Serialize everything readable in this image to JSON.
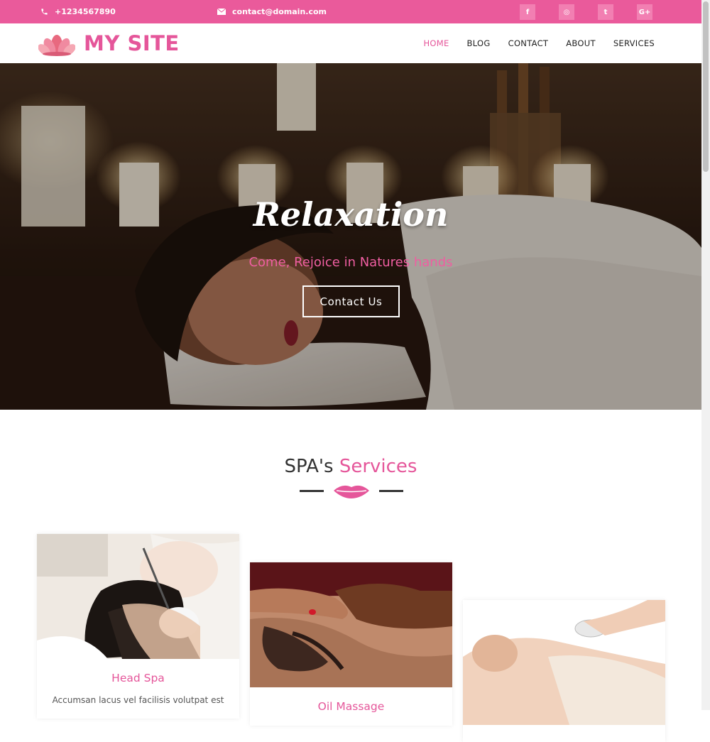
{
  "topbar": {
    "phone": "+1234567890",
    "email": "contact@domain.com",
    "phone_icon": "phone-icon",
    "email_icon": "envelope-icon",
    "socials": [
      {
        "name": "facebook-icon",
        "glyph": "f"
      },
      {
        "name": "instagram-icon",
        "glyph": "◎"
      },
      {
        "name": "twitter-icon",
        "glyph": "t"
      },
      {
        "name": "google-plus-icon",
        "glyph": "G+"
      }
    ]
  },
  "nav": {
    "logo_text": "MY SITE",
    "logo_icon": "lotus-icon",
    "items": [
      "HOME",
      "BLOG",
      "CONTACT",
      "ABOUT",
      "SERVICES"
    ],
    "active": "HOME"
  },
  "hero": {
    "title": "Relaxation",
    "subtitle": "Come, Rejoice in Natures hands",
    "button": "Contact Us"
  },
  "services": {
    "heading_main": "SPA's",
    "heading_accent": "Services",
    "divider_icon": "lips-icon",
    "cards": [
      {
        "title": "Head Spa",
        "text": "Accumsan lacus vel facilisis volutpat est"
      },
      {
        "title": "Oil Massage",
        "text": ""
      },
      {
        "title": "",
        "text": ""
      }
    ]
  },
  "colors": {
    "brand_pink": "#ea5a9b",
    "social_bg": "#f27fb2",
    "text_dark": "#222222"
  }
}
